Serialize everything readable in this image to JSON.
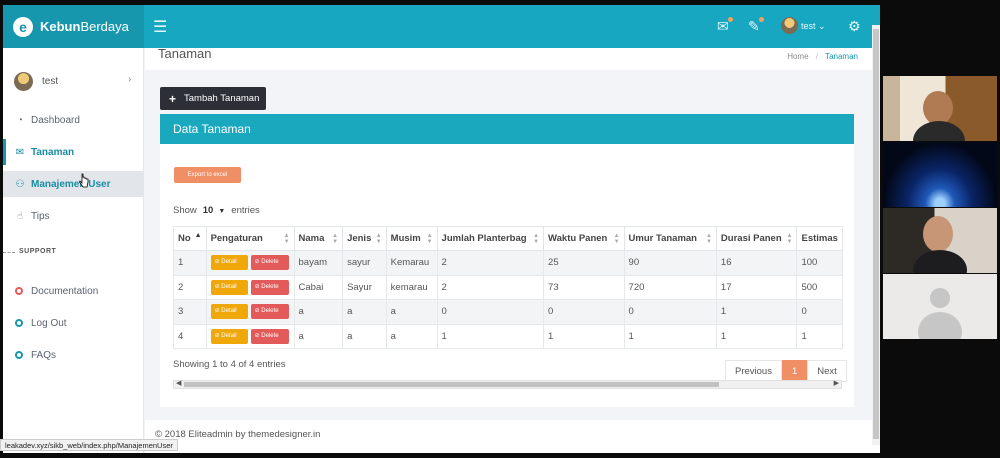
{
  "brand": {
    "name_bold": "Kebun",
    "name_light": "Berdaya",
    "logo_letter": "e"
  },
  "topbar": {
    "username": "test",
    "caret": "⌄"
  },
  "sidebar": {
    "username": "test",
    "items": [
      {
        "label": "Dashboard",
        "icon": "gauge-icon",
        "glyph": "◔"
      },
      {
        "label": "Tanaman",
        "icon": "mail-icon",
        "glyph": "✉"
      },
      {
        "label": "Manajemen User",
        "icon": "users-icon",
        "glyph": "⚇"
      },
      {
        "label": "Tips",
        "icon": "thumbs-up-icon",
        "glyph": "☝"
      }
    ],
    "support_label": "SUPPORT",
    "support_items": [
      {
        "label": "Documentation",
        "color": "#e35a5a"
      },
      {
        "label": "Log Out",
        "color": "#1797ae"
      },
      {
        "label": "FAQs",
        "color": "#1797ae"
      }
    ]
  },
  "page": {
    "title": "Tanaman",
    "breadcrumb_home": "Home",
    "breadcrumb_sep": "/",
    "breadcrumb_current": "Tanaman",
    "add_button": "Tambah Tanaman",
    "card_title": "Data Tanaman",
    "export_button": "Export to excel",
    "show_label": "Show",
    "show_value": "10",
    "entries_label": "entries"
  },
  "table": {
    "columns": [
      "No",
      "Pengaturan",
      "Nama",
      "Jenis",
      "Musim",
      "Jumlah Planterbag",
      "Waktu Panen",
      "Umur Tanaman",
      "Durasi Panen",
      "Estimas"
    ],
    "detail_label": "⊘ Detail",
    "delete_label": "⊘ Delete",
    "rows": [
      [
        "1",
        "bayam",
        "sayur",
        "Kemarau",
        "2",
        "25",
        "90",
        "16",
        "100"
      ],
      [
        "2",
        "Cabai",
        "Sayur",
        "kemarau",
        "2",
        "73",
        "720",
        "17",
        "500"
      ],
      [
        "3",
        "a",
        "a",
        "a",
        "0",
        "0",
        "0",
        "1",
        "0"
      ],
      [
        "4",
        "a",
        "a",
        "a",
        "1",
        "1",
        "1",
        "1",
        "1"
      ]
    ]
  },
  "pagination": {
    "info": "Showing 1 to 4 of 4 entries",
    "previous": "Previous",
    "current": "1",
    "next": "Next"
  },
  "footer": {
    "text": "© 2018 Eliteadmin by themedesigner.in"
  },
  "status_url": "leakadev.xyz/sikb_web/index.php/ManajemenUser",
  "colors": {
    "primary": "#1aa8bf",
    "accent": "#f08e66",
    "detail": "#efa70a",
    "delete": "#e35a5a"
  }
}
